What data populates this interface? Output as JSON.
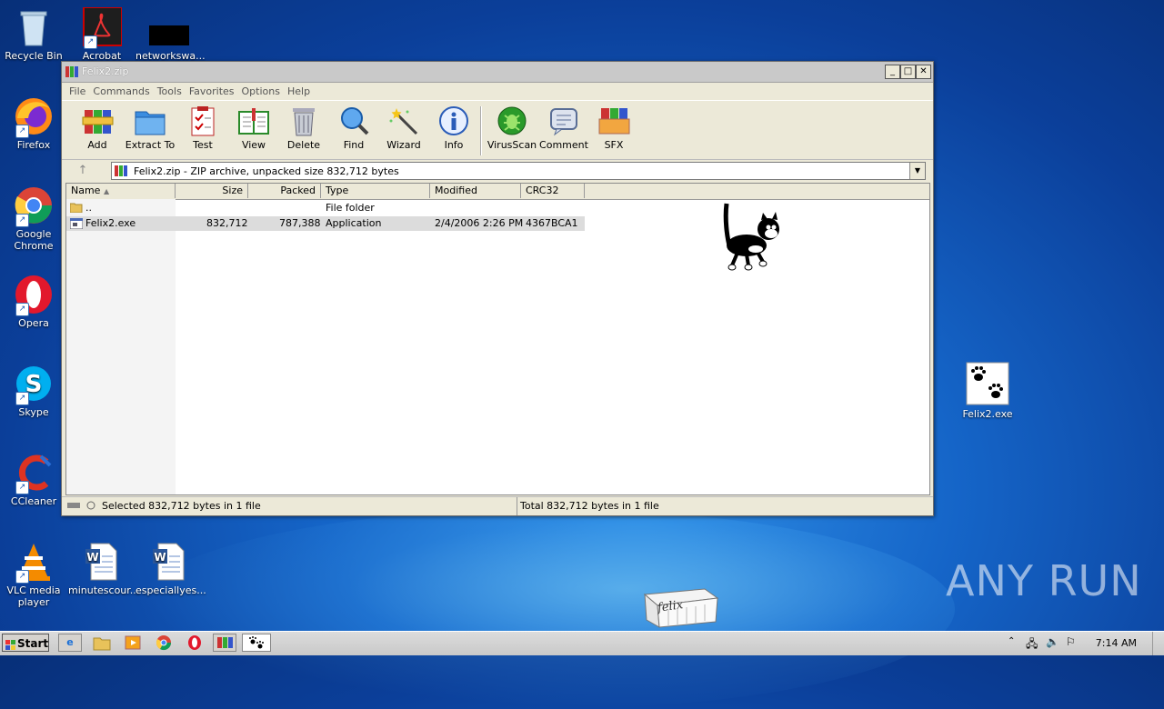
{
  "desktop": {
    "icons_left": [
      {
        "label": "Recycle Bin",
        "icon": "recycle-bin-icon"
      },
      {
        "label": "Acrobat",
        "icon": "acrobat-icon"
      },
      {
        "label": "networkswa...",
        "icon": "network-icon"
      },
      {
        "label": "Firefox",
        "icon": "firefox-icon"
      },
      {
        "label": "Google Chrome",
        "icon": "chrome-icon"
      },
      {
        "label": "Opera",
        "icon": "opera-icon"
      },
      {
        "label": "Skype",
        "icon": "skype-icon"
      },
      {
        "label": "CCleaner",
        "icon": "ccleaner-icon"
      },
      {
        "label": "VLC media player",
        "icon": "vlc-icon"
      },
      {
        "label": "minutescour...",
        "icon": "word-doc-icon"
      },
      {
        "label": "especiallyes...",
        "icon": "word-doc-icon"
      }
    ],
    "felix_icon_label": "Felix2.exe",
    "box_label": "felix",
    "watermark": "ANY RUN"
  },
  "window": {
    "title": "Felix2.zip",
    "menu": [
      "File",
      "Commands",
      "Tools",
      "Favorites",
      "Options",
      "Help"
    ],
    "toolbar": [
      {
        "label": "Add",
        "icon": "add-icon"
      },
      {
        "label": "Extract To",
        "icon": "extract-icon"
      },
      {
        "label": "Test",
        "icon": "test-icon"
      },
      {
        "label": "View",
        "icon": "view-icon"
      },
      {
        "label": "Delete",
        "icon": "delete-icon"
      },
      {
        "label": "Find",
        "icon": "find-icon"
      },
      {
        "label": "Wizard",
        "icon": "wizard-icon"
      },
      {
        "label": "Info",
        "icon": "info-icon"
      },
      {
        "label": "VirusScan",
        "icon": "virusscan-icon"
      },
      {
        "label": "Comment",
        "icon": "comment-icon"
      },
      {
        "label": "SFX",
        "icon": "sfx-icon"
      }
    ],
    "address": "Felix2.zip - ZIP archive, unpacked size 832,712 bytes",
    "columns": [
      "Name",
      "Size",
      "Packed",
      "Type",
      "Modified",
      "CRC32"
    ],
    "rows": [
      {
        "name": "..",
        "size": "",
        "packed": "",
        "type": "File folder",
        "modified": "",
        "crc": ""
      },
      {
        "name": "Felix2.exe",
        "size": "832,712",
        "packed": "787,388",
        "type": "Application",
        "modified": "2/4/2006 2:26 PM",
        "crc": "4367BCA1"
      }
    ],
    "status_left": "Selected 832,712 bytes in 1 file",
    "status_right": "Total 832,712 bytes in 1 file"
  },
  "taskbar": {
    "start": "Start",
    "clock": "7:14 AM"
  }
}
